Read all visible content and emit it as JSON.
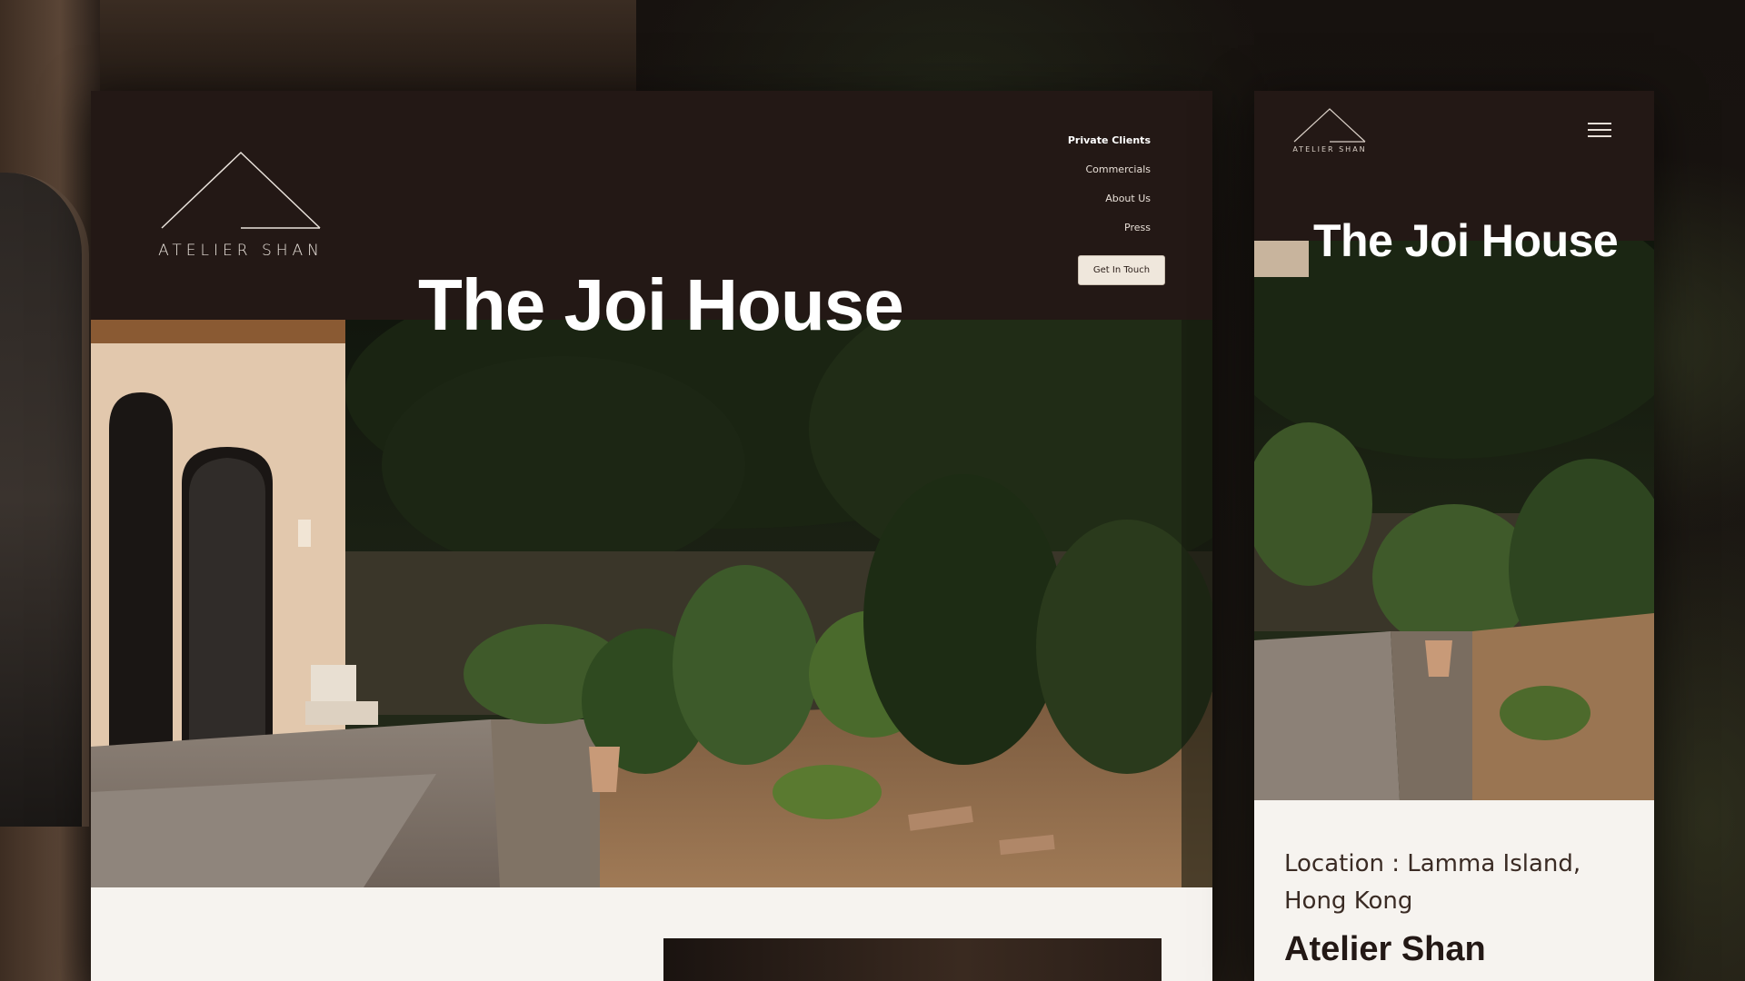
{
  "desktop": {
    "logo": {
      "text": "ATELIER SHAN"
    },
    "nav": {
      "items": [
        {
          "label": "Private Clients"
        },
        {
          "label": "Commercials"
        },
        {
          "label": "About Us"
        },
        {
          "label": "Press"
        }
      ],
      "cta_label": "Get In Touch"
    },
    "hero": {
      "title": "The Joi House"
    }
  },
  "mobile": {
    "logo": {
      "text": "ATELIER SHAN"
    },
    "hero": {
      "title": "The Joi House"
    },
    "info": {
      "location": "Location : Lamma Island, Hong Kong",
      "heading": "Atelier Shan"
    }
  },
  "colors": {
    "header_bg": "#231815",
    "content_bg": "#f6f3ef",
    "cta_bg": "#efe7dc",
    "text_dark": "#3a2b24"
  },
  "icons": [
    "logo-triangle-icon",
    "hamburger-menu-icon"
  ]
}
